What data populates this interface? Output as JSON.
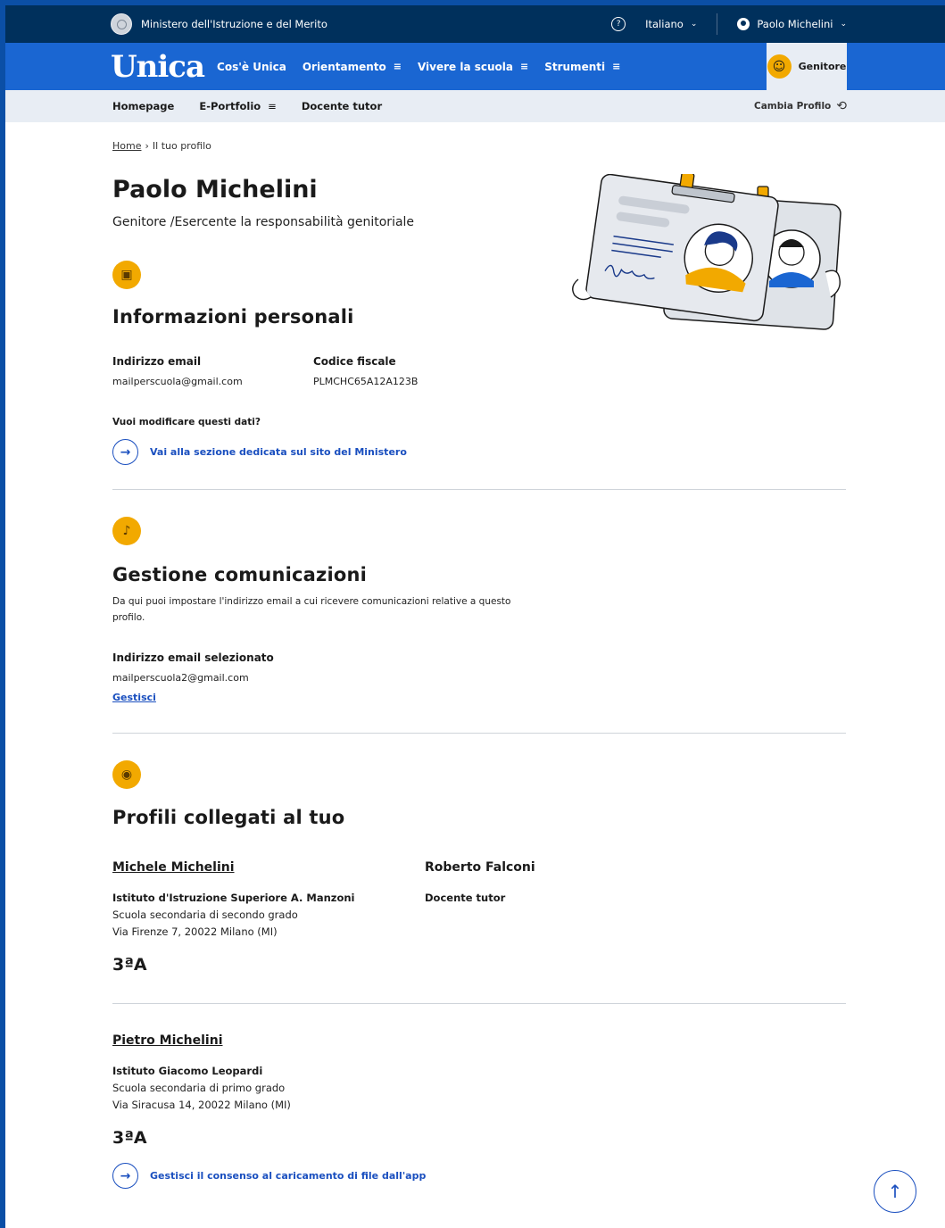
{
  "topbar": {
    "ministry": "Ministero dell'Istruzione e del Merito",
    "help_icon": "question-circle-icon",
    "language": "Italiano",
    "user_name": "Paolo Michelini"
  },
  "mainnav": {
    "logo": "Unica",
    "links": [
      "Cos'è Unica",
      "Orientamento",
      "Vivere la scuola",
      "Strumenti"
    ],
    "profile_tab": "Genitore"
  },
  "subnav": {
    "items": [
      "Homepage",
      "E-Portfolio",
      "Docente tutor"
    ],
    "cambia": "Cambia Profilo"
  },
  "breadcrumb": {
    "home": "Home",
    "current": "Il tuo profilo"
  },
  "profile": {
    "name": "Paolo Michelini",
    "role": "Genitore /Esercente la responsabilità genitoriale"
  },
  "personal": {
    "title": "Informazioni personali",
    "email_label": "Indirizzo email",
    "email": "mailperscuola@gmail.com",
    "cf_label": "Codice fiscale",
    "cf": "PLMCHC65A12A123B",
    "modify_q": "Vuoi modificare questi dati?",
    "modify_link": "Vai alla sezione dedicata sul sito del Ministero"
  },
  "comms": {
    "title": "Gestione comunicazioni",
    "desc": "Da qui puoi impostare l'indirizzo email a cui ricevere comunicazioni relative a questo profilo.",
    "selected_label": "Indirizzo email selezionato",
    "selected_email": "mailperscuola2@gmail.com",
    "manage": "Gestisci"
  },
  "linked": {
    "title": "Profili collegati al tuo",
    "students": [
      {
        "name": "Michele Michelini",
        "school": "Istituto d'Istruzione Superiore A. Manzoni",
        "grade": "Scuola secondaria di secondo grado",
        "address": "Via Firenze 7, 20022 Milano (MI)",
        "class": "3ªA",
        "tutor_name": "Roberto Falconi",
        "tutor_role": "Docente tutor"
      },
      {
        "name": "Pietro Michelini",
        "school": "Istituto Giacomo Leopardi",
        "grade": "Scuola secondaria di primo grado",
        "address": "Via Siracusa 14, 20022 Milano (MI)",
        "class": "3ªA"
      }
    ],
    "consent_link": "Gestisci il consenso al caricamento di file dall'app"
  },
  "colors": {
    "dark_blue": "#00305c",
    "primary_blue": "#1a66d2",
    "accent": "#f2a900",
    "link": "#1a4fbf"
  }
}
